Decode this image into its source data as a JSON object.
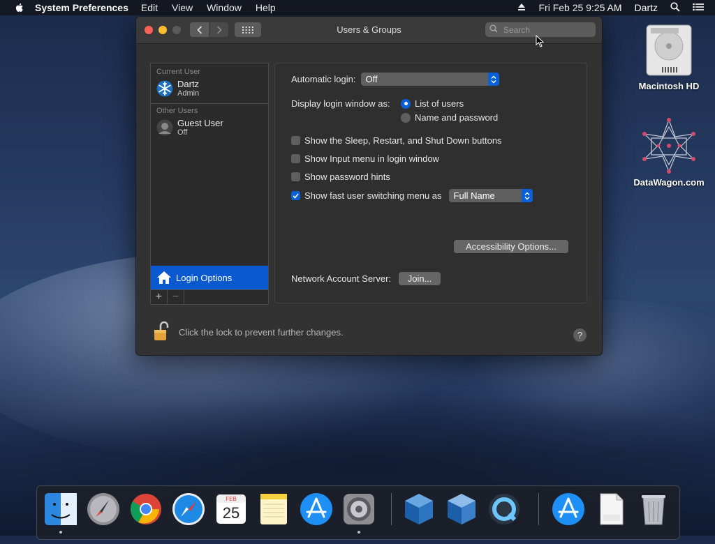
{
  "menubar": {
    "app_name": "System Preferences",
    "menus": [
      "Edit",
      "View",
      "Window",
      "Help"
    ],
    "datetime": "Fri Feb 25  9:25 AM",
    "user": "Dartz"
  },
  "window": {
    "title": "Users & Groups",
    "search_placeholder": "Search"
  },
  "sidebar": {
    "current_user_header": "Current User",
    "current_user": {
      "name": "Dartz",
      "role": "Admin"
    },
    "other_users_header": "Other Users",
    "other_users": [
      {
        "name": "Guest User",
        "status": "Off"
      }
    ],
    "login_options_label": "Login Options",
    "add_label": "+",
    "remove_label": "−"
  },
  "login_options": {
    "automatic_login_label": "Automatic login:",
    "automatic_login_value": "Off",
    "display_login_label": "Display login window as:",
    "radio_list_of_users": "List of users",
    "radio_name_password": "Name and password",
    "cb_sleep_restart": "Show the Sleep, Restart, and Shut Down buttons",
    "cb_input_menu": "Show Input menu in login window",
    "cb_password_hints": "Show password hints",
    "cb_fast_user": "Show fast user switching menu as",
    "fast_user_value": "Full Name",
    "accessibility_button": "Accessibility Options...",
    "network_server_label": "Network Account Server:",
    "join_button": "Join..."
  },
  "footer": {
    "lock_text": "Click the lock to prevent further changes.",
    "help_label": "?"
  },
  "desktop": {
    "icons": [
      {
        "label": "Macintosh HD"
      },
      {
        "label": "DataWagon.com"
      }
    ]
  },
  "dock": {
    "calendar_month": "FEB",
    "calendar_day": "25"
  },
  "colors": {
    "accent": "#0a60d8",
    "close": "#fe5f57",
    "minimize": "#febc2e"
  }
}
